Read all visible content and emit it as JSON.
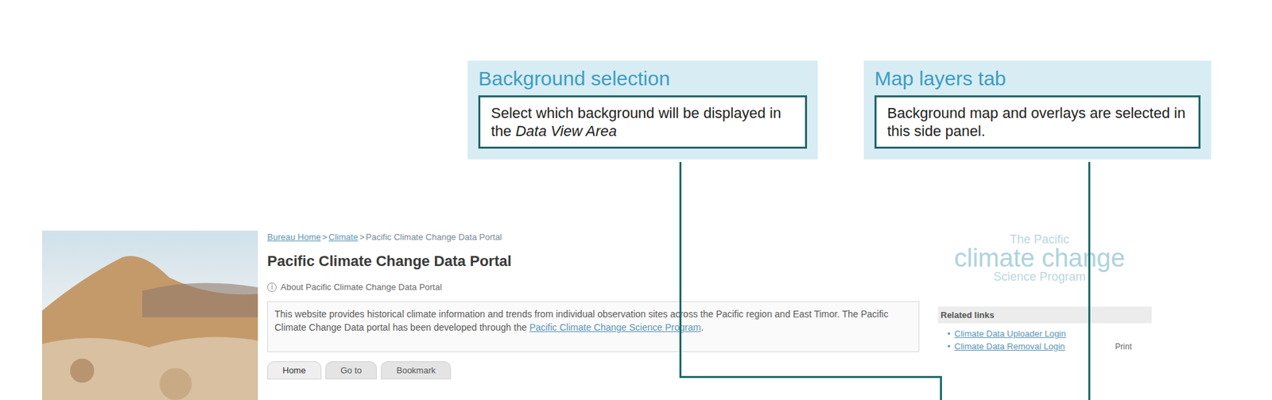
{
  "callouts": [
    {
      "title": "Background selection",
      "text": "Select which background will be displayed in the ",
      "emphasis": "Data View Area"
    },
    {
      "title": "Map layers tab",
      "text": "Background map and overlays are selected in this side panel.",
      "emphasis": ""
    }
  ],
  "breadcrumb": {
    "items": [
      "Bureau Home",
      "Climate",
      "Pacific Climate Change Data Portal"
    ],
    "separator": ">"
  },
  "page_title": "Pacific Climate Change Data Portal",
  "about": {
    "icon": "i",
    "label": "About Pacific Climate Change Data Portal"
  },
  "description": {
    "text": "This website provides historical climate information and trends from individual observation sites across the Pacific region and East Timor. The Pacific Climate Change Data portal has been developed through the ",
    "link": "Pacific Climate Change Science Program",
    "end": "."
  },
  "tabs": [
    {
      "label": "Home",
      "selected": true
    },
    {
      "label": "Go to",
      "selected": false
    },
    {
      "label": "Bookmark",
      "selected": false
    }
  ],
  "logo": {
    "line1": "The Pacific",
    "line2": "climate change",
    "line3": "Science Program"
  },
  "related": {
    "title": "Related links",
    "bullet": "•",
    "links": [
      "Climate Data Uploader Login",
      "Climate Data Removal Login"
    ]
  },
  "print": "Print"
}
